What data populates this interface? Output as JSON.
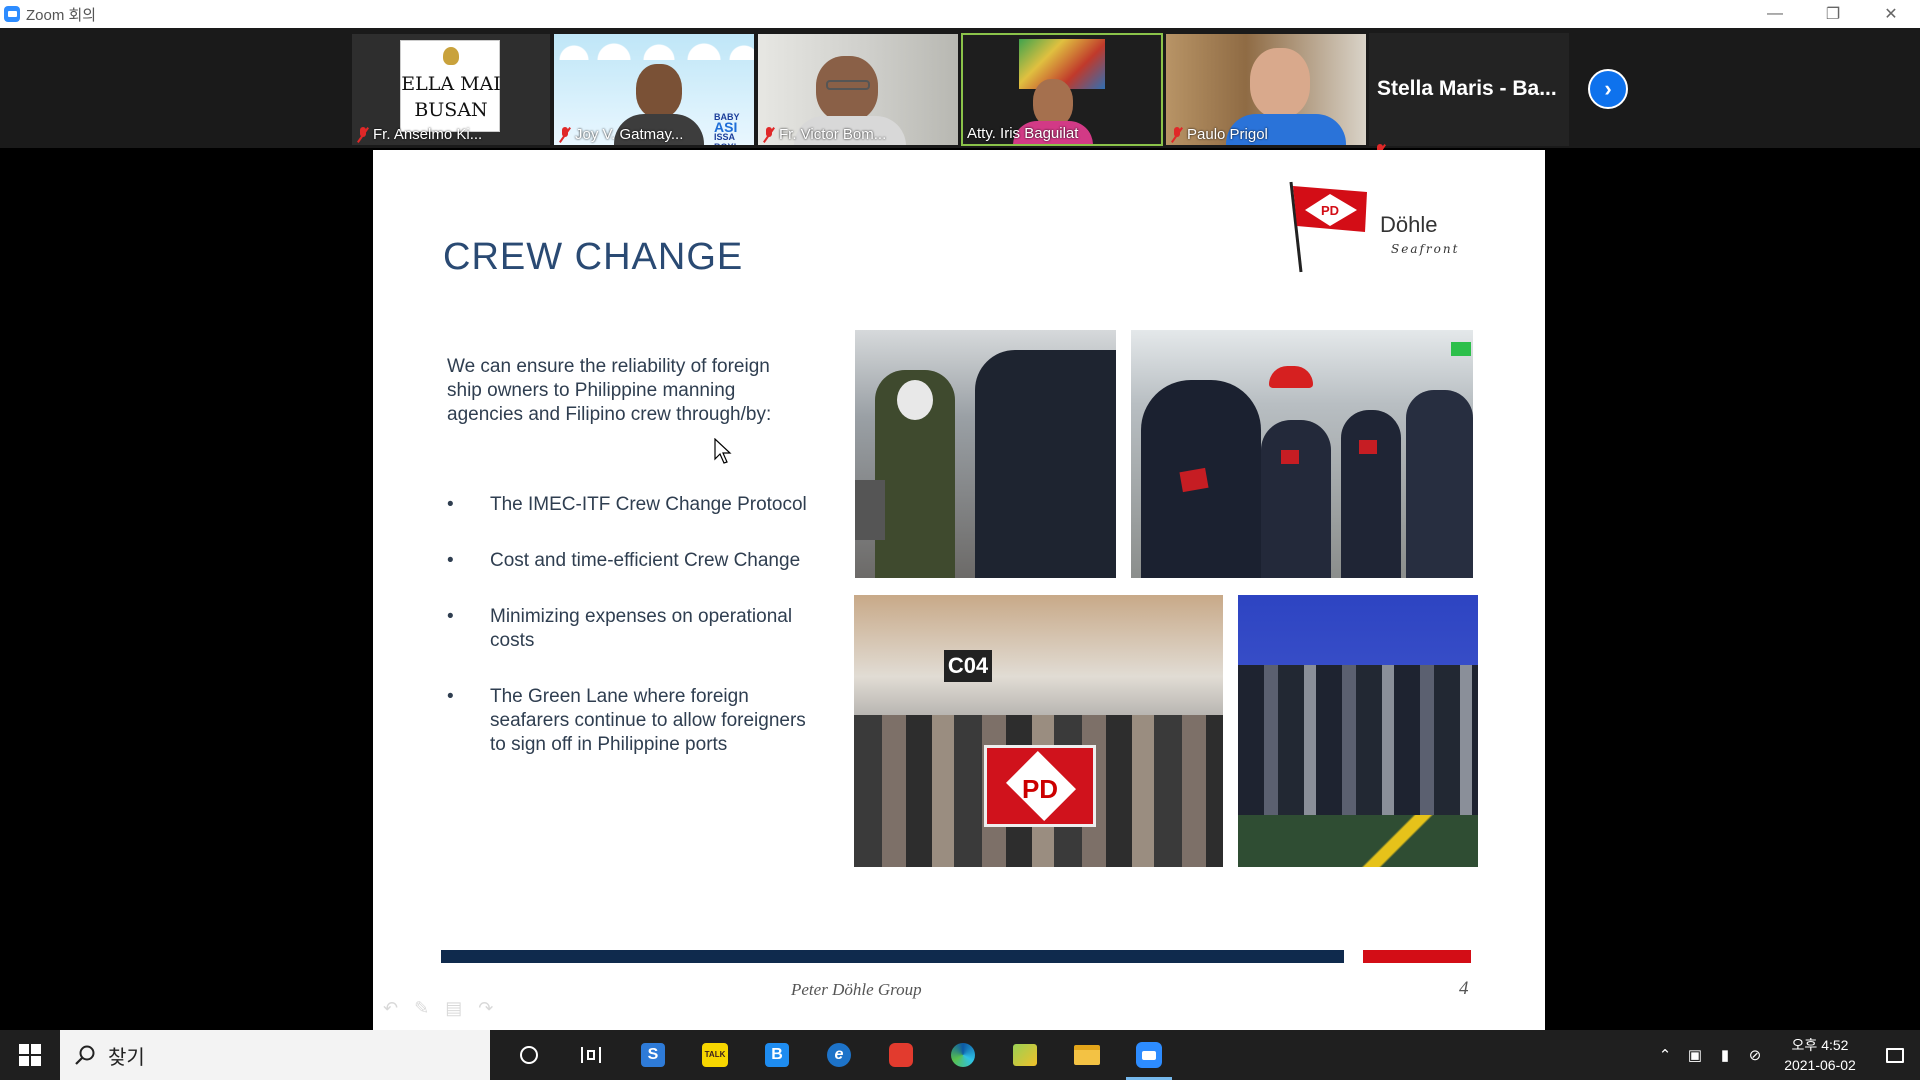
{
  "window": {
    "title": "Zoom 회의",
    "minimize_icon": "minimize-icon",
    "restore_icon": "restore-icon",
    "close_icon": "close-icon"
  },
  "participants": [
    {
      "name": "Fr. Anselmo Ki...",
      "muted": true,
      "sign_line1": "ELLA MAI",
      "sign_line2": "BUSAN"
    },
    {
      "name": "Joy V. Gatmay...",
      "muted": true,
      "badge_line1": "BABY",
      "badge_line2": "ISSA BOY!",
      "badge_mark": "ASI"
    },
    {
      "name": "Fr. Victor Bom...",
      "muted": true
    },
    {
      "name": "Atty. Iris Baguilat",
      "muted": false
    },
    {
      "name": "Paulo Prigol",
      "muted": true
    }
  ],
  "name_only_tile": {
    "name": "Stella Maris - Ba...",
    "muted": true
  },
  "next_button_icon": "chevron-right-icon",
  "slide": {
    "title": "CREW CHANGE",
    "logo": {
      "brand": "Döhle",
      "sub": "Seafront",
      "flag_text": "PD"
    },
    "intro": "We can ensure the reliability of foreign ship owners to Philippine manning agencies and Filipino crew through/by:",
    "bullets": [
      "The IMEC-ITF Crew Change Protocol",
      "Cost and time-efficient Crew Change",
      "Minimizing expenses on operational costs",
      "The Green Lane where foreign seafarers continue to allow foreigners to sign off in Philippine ports"
    ],
    "photo_gate_sign": "C04",
    "photo_banner": "PD",
    "footer": "Peter Döhle Group",
    "page_number": "4"
  },
  "taskbar": {
    "search_label": "찾기",
    "apps": [
      "task-view-icon",
      "cortana-icon",
      "app-s-icon",
      "kakaotalk-icon",
      "app-b-icon",
      "ie-icon",
      "app-red-icon",
      "edge-icon",
      "maps-icon",
      "file-explorer-icon",
      "zoom-icon"
    ],
    "clock_time": "오후 4:52",
    "clock_date": "2021-06-02"
  },
  "colors": {
    "slide_title": "#2a4a73",
    "bar_blue": "#0f2a4d",
    "bar_red": "#d30d16",
    "zoom_blue": "#0e72ed",
    "active_speaker": "#8bc34a"
  }
}
